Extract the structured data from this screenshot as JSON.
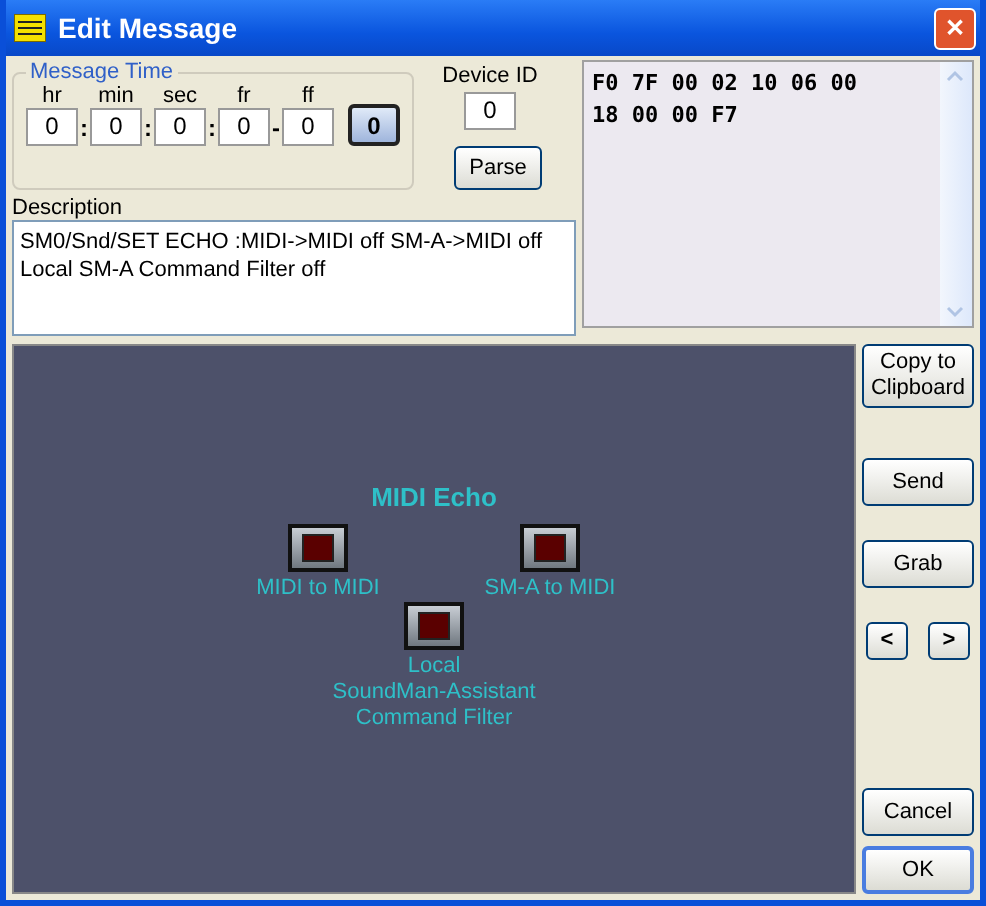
{
  "window": {
    "title": "Edit Message",
    "close": "✕"
  },
  "message_time": {
    "label": "Message Time",
    "fields": [
      {
        "label": "hr",
        "value": "0",
        "separator": ":"
      },
      {
        "label": "min",
        "value": "0",
        "separator": ":"
      },
      {
        "label": "sec",
        "value": "0",
        "separator": ":"
      },
      {
        "label": "fr",
        "value": "0",
        "separator": "-"
      },
      {
        "label": "ff",
        "value": "0"
      }
    ],
    "button": "0"
  },
  "device_id": {
    "label": "Device ID",
    "value": "0"
  },
  "parse_button": "Parse",
  "description": {
    "label": "Description",
    "lines": [
      "SM0/Snd/SET ECHO :MIDI->MIDI off SM-A->MIDI off",
      "Local SM-A Command Filter off"
    ]
  },
  "hex_lines": [
    "F0 7F 00 02 10 06 00",
    "18 00 00 F7"
  ],
  "panel": {
    "title": "MIDI Echo",
    "toggles": [
      {
        "label": "MIDI to MIDI",
        "on": false
      },
      {
        "label": "SM-A to MIDI",
        "on": false
      },
      {
        "label": "Local\nSoundMan-Assistant\nCommand Filter",
        "on": false
      }
    ]
  },
  "buttons": [
    {
      "kind": "wide",
      "label": "Copy to\nClipboard"
    },
    {
      "kind": "wide",
      "label": "Send"
    },
    {
      "kind": "wide",
      "label": "Grab"
    },
    {
      "kind": "pair",
      "labels": [
        "<",
        ">"
      ]
    },
    {
      "kind": "wide",
      "label": "Cancel"
    },
    {
      "kind": "default",
      "label": "OK"
    }
  ]
}
